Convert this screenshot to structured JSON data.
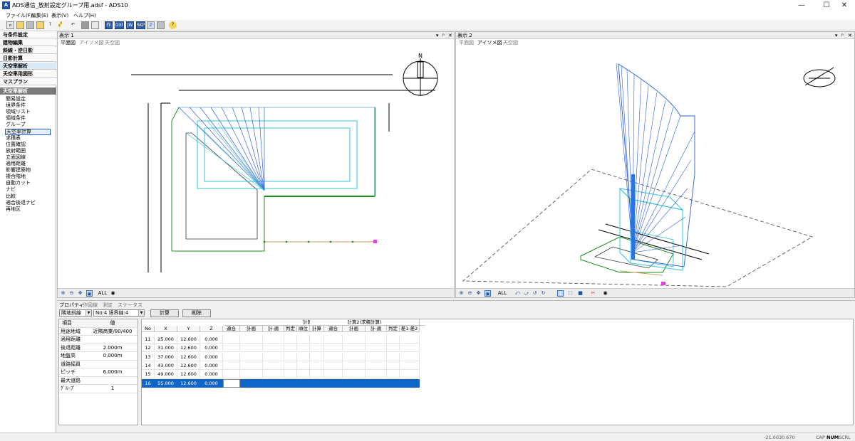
{
  "window": {
    "title": "ADS通信_放射設定グループ用.adsf - ADS10",
    "app_icon": "A"
  },
  "menu": [
    "ファイル(F)",
    "編集(E)",
    "表示(V)",
    "ヘルプ(H)"
  ],
  "toolbar": {
    "buttons": [
      {
        "icon": "new-file-icon"
      },
      {
        "icon": "open-folder-icon"
      },
      {
        "icon": "save-icon"
      },
      {
        "icon": "save-as-icon"
      },
      {
        "icon": "info-icon"
      },
      {
        "icon": "flag-icon"
      },
      {
        "icon": "undo-icon"
      },
      {
        "icon": "print-icon"
      },
      {
        "icon": "print-preview-icon"
      },
      {
        "icon": "import-icon",
        "label": "作"
      },
      {
        "icon": "dxf-icon",
        "label": "DXF"
      },
      {
        "icon": "jww-icon",
        "label": "JW"
      },
      {
        "icon": "skp-icon",
        "label": "SKP"
      },
      {
        "icon": "z-icon",
        "label": "Z"
      },
      {
        "icon": "disabled-icon"
      },
      {
        "icon": "help-icon",
        "label": "?"
      }
    ]
  },
  "sidebar": {
    "sections": [
      "与条件設定",
      "建物編集",
      "斜線・逆日影",
      "日影計算",
      "天空率解析",
      "天空率用図形",
      "マスプラン"
    ],
    "active_section": "天空率解析",
    "sub_header": "天空率解析",
    "items": [
      "簡易設定",
      "境界条件",
      "領域リスト",
      "領域条件",
      "グループ",
      "天空率計算",
      "求積表",
      "位置確認",
      "放射範囲",
      "立面図線",
      "適用距離",
      "影響建築物",
      "複合階地",
      "自動カット",
      "ナビ",
      "比較",
      "適合後退ナビ",
      "再地区"
    ],
    "selected_item": "天空率計算"
  },
  "view1": {
    "title": "表示 1",
    "controls": [
      "▾",
      "ᵖ",
      "✕"
    ],
    "tabs": [
      "平面図",
      "アイソメ図",
      "天空図"
    ],
    "active_tab": "平面図",
    "north_label": "N",
    "tools_label": "ALL"
  },
  "view2": {
    "title": "表示 2",
    "controls": [
      "▾",
      "ᵖ",
      "✕"
    ],
    "tabs": [
      "平面図",
      "アイソメ図",
      "天空図"
    ],
    "active_tab": "アイソメ図",
    "tools_label": "ALL"
  },
  "bottom": {
    "tabs": [
      "プロパティ",
      "作図線",
      "測定",
      "ステータス"
    ],
    "active_tab": "プロパティ",
    "select1": "隣地斜線",
    "select2": "No:4 境界線:4",
    "calc_button": "計算",
    "delete_button": "削除",
    "prop_header": {
      "key": "項目",
      "value": "値"
    },
    "properties": [
      {
        "k": "用途地域",
        "v": "近隣商業/80/400"
      },
      {
        "k": "適用距離",
        "v": ""
      },
      {
        "k": "後退距離",
        "v": "2.000m"
      },
      {
        "k": "地盤高",
        "v": "0.000m"
      },
      {
        "k": "道路幅員",
        "v": ""
      },
      {
        "k": "ピッチ",
        "v": "6.000m"
      },
      {
        "k": "最大道路",
        "v": ""
      },
      {
        "k": "ｸﾞﾙｰﾌﾟ",
        "v": "1"
      }
    ],
    "group1_title": "計算1(システム計算)",
    "group2_title": "計算2(求積計算)",
    "columns": [
      "No",
      "X",
      "Y",
      "Z",
      "適合",
      "計画",
      "計-適",
      "判定",
      "順位",
      "計算",
      "適合",
      "計画",
      "計-適",
      "判定",
      "差1-差2"
    ],
    "rows": [
      [
        "11",
        "25.000",
        "12.600",
        "0.000"
      ],
      [
        "12",
        "31.000",
        "12.600",
        "0.000"
      ],
      [
        "13",
        "37.000",
        "12.600",
        "0.000"
      ],
      [
        "14",
        "43.000",
        "12.600",
        "0.000"
      ],
      [
        "15",
        "49.000",
        "12.600",
        "0.000"
      ],
      [
        "16",
        "55.000",
        "12.600",
        "0.000"
      ]
    ],
    "selected_row": "16"
  },
  "status": {
    "coord_x": "-21.003",
    "coord_y": "0.670",
    "indicators": [
      "CAP",
      "NUM",
      "SCRL"
    ]
  },
  "colors": {
    "accent": "#1065c8",
    "ray_blue": "#2a5fd6",
    "cyan": "#33c3d8",
    "green": "#1e8c1e"
  }
}
